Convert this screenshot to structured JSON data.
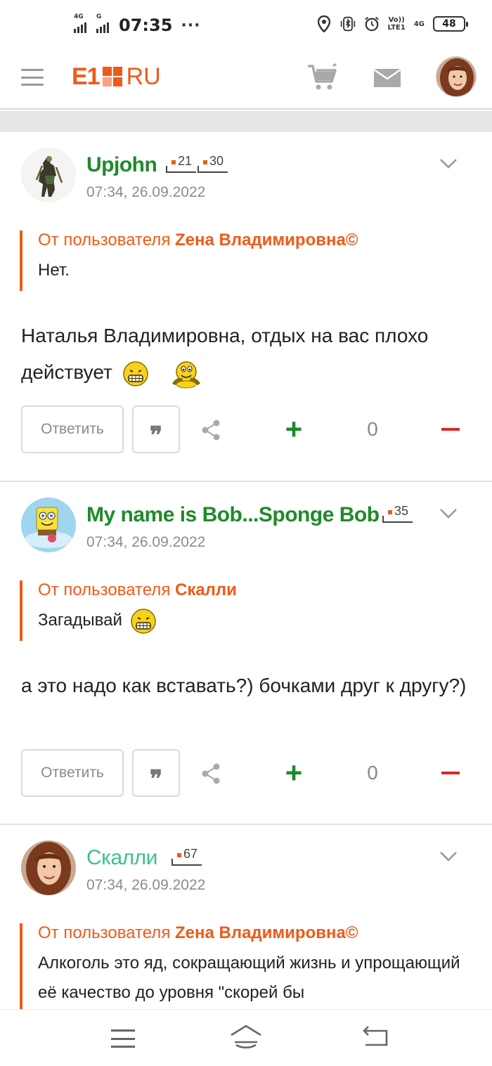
{
  "status_bar": {
    "sim1_label": "4G",
    "sim2_label": "G",
    "time": "07:35",
    "more": "···",
    "volte": "Vo))\nLTE1",
    "net": "4G",
    "battery": "48"
  },
  "header": {
    "logo_e1": "E1",
    "logo_ru": "RU",
    "brand_color": "#f05a18"
  },
  "comments": [
    {
      "author": "Upjohn",
      "badges": [
        "21",
        "30"
      ],
      "date": "07:34, 26.09.2022",
      "quote_prefix": "От пользователя ",
      "quote_user": "Zена Владимировна©",
      "quote_text": "Нет.",
      "text": "Наталья Владимировна, отдых на вас плохо действует",
      "reply_label": "Ответить",
      "quote_btn": "❞",
      "score": "0"
    },
    {
      "author": "My name is Bob...Sponge Bob",
      "badges": [
        "35"
      ],
      "date": "07:34, 26.09.2022",
      "quote_prefix": "От пользователя ",
      "quote_user": "Скалли",
      "quote_text": "Загадывай",
      "text": "а это надо как вставать?) бочками друг к другу?)",
      "reply_label": "Ответить",
      "quote_btn": "❞",
      "score": "0"
    },
    {
      "author": "Скалли",
      "badges": [
        "67"
      ],
      "date": "07:34, 26.09.2022",
      "quote_prefix": "От пользователя ",
      "quote_user": "Zена Владимировна©",
      "quote_text": "Алкоголь это яд, сокращающий жизнь и упрощающий её качество до уровня \"скорей бы"
    }
  ],
  "icons": {
    "menu": "hamburger-icon",
    "cart": "cart-icon",
    "mail": "mail-icon",
    "share": "share-icon",
    "chevron": "chevron-down-icon"
  },
  "colors": {
    "author_green": "#1f8a2a",
    "author_teal": "#3cc28c",
    "minus_red": "#e0262a",
    "quote_orange": "#f05a18"
  }
}
